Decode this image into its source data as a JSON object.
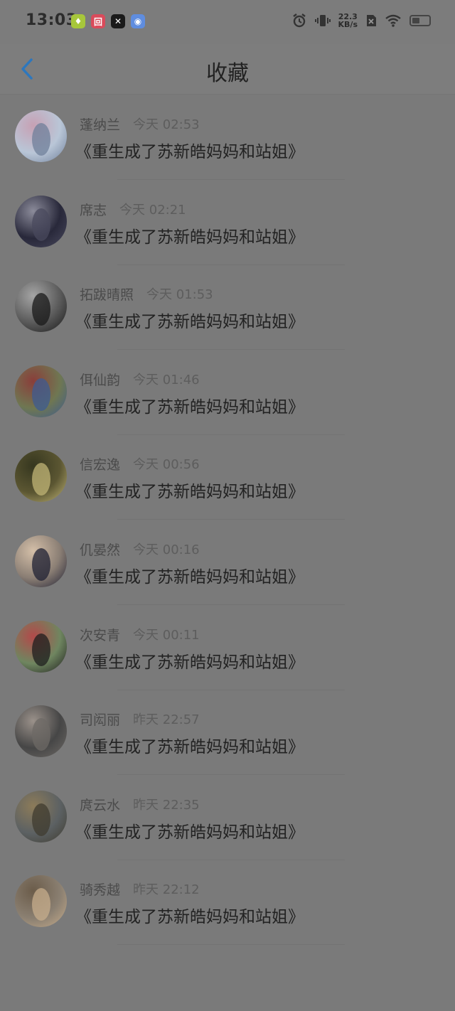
{
  "status_bar": {
    "time": "13:03",
    "apps": [
      {
        "icon": "pear-app-icon",
        "color": "#a7c73b",
        "glyph": "♦"
      },
      {
        "icon": "red-app-icon",
        "color": "#d94b5b",
        "glyph": "回"
      },
      {
        "icon": "capcut-app-icon",
        "color": "#1a1a1a",
        "glyph": "✕"
      },
      {
        "icon": "blue-app-icon",
        "color": "#5f8ddf",
        "glyph": "◉"
      }
    ],
    "network_speed_value": "22.3",
    "network_speed_unit": "KB/s",
    "battery_level": 0.38
  },
  "header": {
    "title": "收藏"
  },
  "items": [
    {
      "user": "蓬纳兰",
      "time": "今天 02:53",
      "title": "《重生成了苏新皓妈妈和站姐》",
      "avatar_colors": [
        "#b9c6d7",
        "#6f7f9a",
        "#c7a1b4"
      ]
    },
    {
      "user": "席志",
      "time": "今天 02:21",
      "title": "《重生成了苏新皓妈妈和站姐》",
      "avatar_colors": [
        "#28283a",
        "#4a4a5e",
        "#8b8b9a"
      ]
    },
    {
      "user": "拓跋晴照",
      "time": "今天 01:53",
      "title": "《重生成了苏新皓妈妈和站姐》",
      "avatar_colors": [
        "#5a5a5a",
        "#181818",
        "#a5a5a5"
      ]
    },
    {
      "user": "佴仙韵",
      "time": "今天 01:46",
      "title": "《重生成了苏新皓妈妈和站姐》",
      "avatar_colors": [
        "#6f7752",
        "#3d5b91",
        "#8a3e3a"
      ]
    },
    {
      "user": "信宏逸",
      "time": "今天 00:56",
      "title": "《重生成了苏新皓妈妈和站姐》",
      "avatar_colors": [
        "#5b5632",
        "#c2b677",
        "#36371f"
      ]
    },
    {
      "user": "仉晏然",
      "time": "今天 00:16",
      "title": "《重生成了苏新皓妈妈和站姐》",
      "avatar_colors": [
        "#8a7e74",
        "#1f2033",
        "#d4bfa8"
      ]
    },
    {
      "user": "次安青",
      "time": "今天 00:11",
      "title": "《重生成了苏新皓妈妈和站姐》",
      "avatar_colors": [
        "#6f8660",
        "#1d1d1d",
        "#b24a4a"
      ]
    },
    {
      "user": "司闳丽",
      "time": "昨天 22:57",
      "title": "《重生成了苏新皓妈妈和站姐》",
      "avatar_colors": [
        "#464646",
        "#6e6a66",
        "#9a918a"
      ]
    },
    {
      "user": "庹云水",
      "time": "昨天 22:35",
      "title": "《重生成了苏新皓妈妈和站姐》",
      "avatar_colors": [
        "#5c6163",
        "#3f3b2f",
        "#8c7b59"
      ]
    },
    {
      "user": "骑秀越",
      "time": "昨天 22:12",
      "title": "《重生成了苏新皓妈妈和站姐》",
      "avatar_colors": [
        "#8a7f71",
        "#c7ad8c",
        "#6b5c4a"
      ]
    }
  ]
}
